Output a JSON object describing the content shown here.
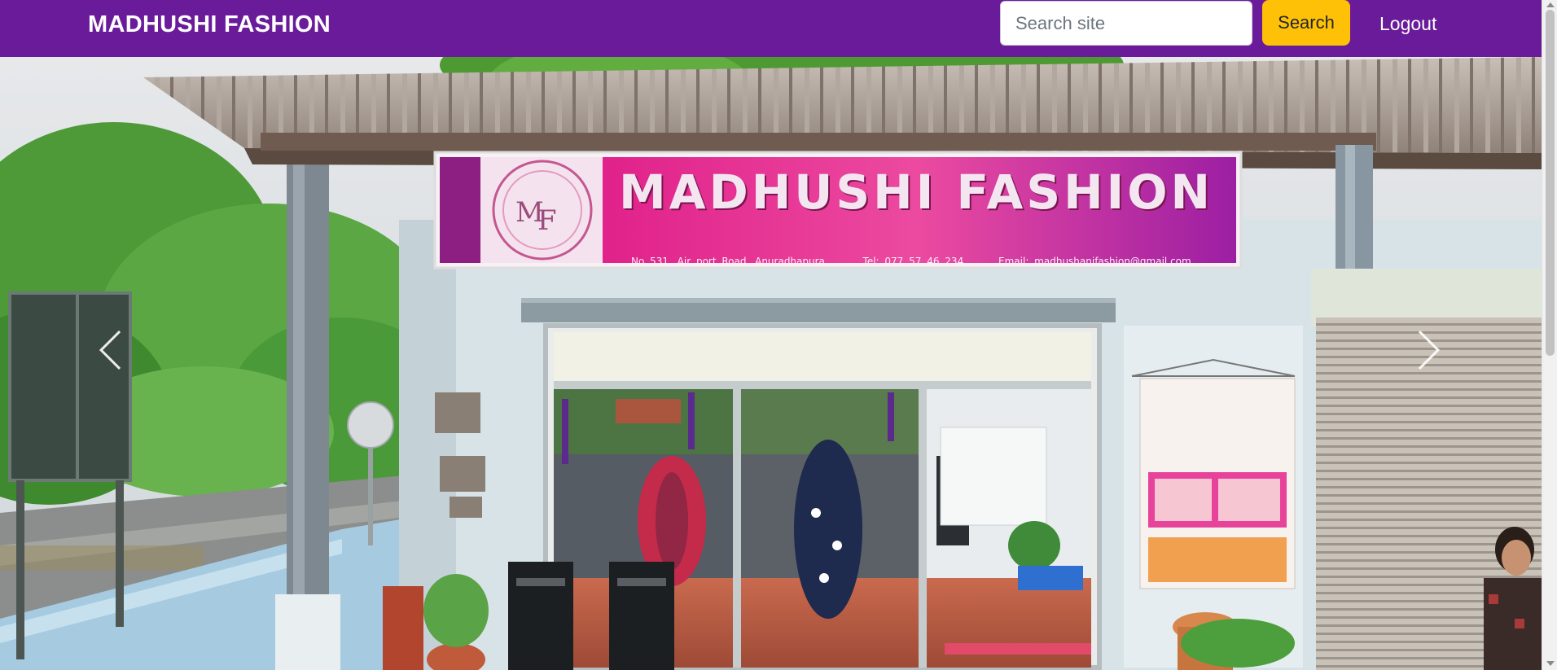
{
  "navbar": {
    "brand": "MADHUSHI FASHION",
    "search_placeholder": "Search site",
    "search_value": "",
    "search_button": "Search",
    "logout": "Logout"
  },
  "hero": {
    "sign_title": "MADHUSHI FASHION",
    "sign_info": [
      "No 531, Air port Road, Anuradhapura.",
      "Tel: 077 57 46 234",
      "Email: madhushanifashion@gmail.com"
    ]
  },
  "colors": {
    "navbar_bg": "#6a1b9a",
    "search_button_bg": "#ffc107",
    "sign_pink": "#e0218a"
  },
  "icons": {
    "prev": "chevron-left-icon",
    "next": "chevron-right-icon"
  }
}
